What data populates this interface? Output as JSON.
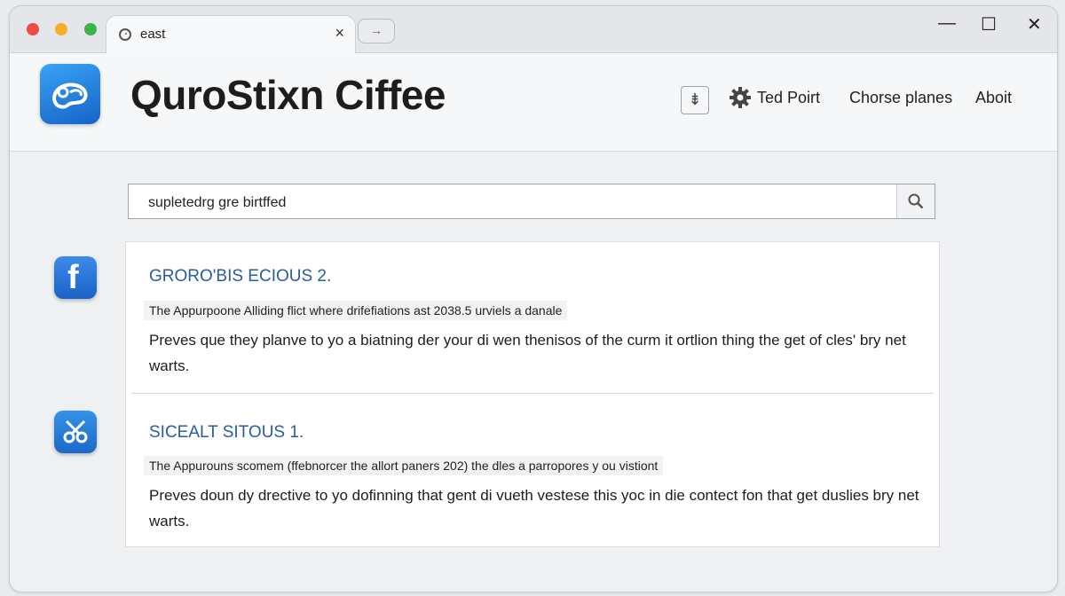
{
  "browser": {
    "tab": {
      "title": "east",
      "close_label": "×"
    },
    "newtab_label": "→",
    "controls": {
      "minimize": "—",
      "maximize": "☐",
      "close": "✕"
    }
  },
  "header": {
    "brand": "QuroStixn Ciffee",
    "plus_label": "⇟",
    "nav": {
      "ted_point": "Ted Poirt",
      "chorse_planes": "Chorse planes",
      "about": "Aboit"
    }
  },
  "search": {
    "value": "supletedrg gre birtffed"
  },
  "results": [
    {
      "title": "GRORO'BIS ECIOUS 2.",
      "meta": "The Appurpoone Alliding flict where drifefiations ast 2038.5 urviels a danale",
      "desc": "Preves que they planve to yo a biatning der your di wen thenisos of the curm it ortlion thing the get of cles' bry net warts."
    },
    {
      "title": "SICEALT SITOUS 1.",
      "meta": "The Appurouns scomem (ffebnorcer the allort paners 202) the dles a parropores y ou vistiont",
      "desc": "Preves doun dy drective to yo dofinning that gent di vueth vestese this yoc in die contect fon that get duslies bry net warts."
    }
  ],
  "icons": {
    "tab": "speedometer-icon",
    "gear": "gear-icon",
    "search": "search-icon",
    "side1": "facebook-icon",
    "side2": "scissors-icon",
    "logo": "app-logo-icon"
  }
}
